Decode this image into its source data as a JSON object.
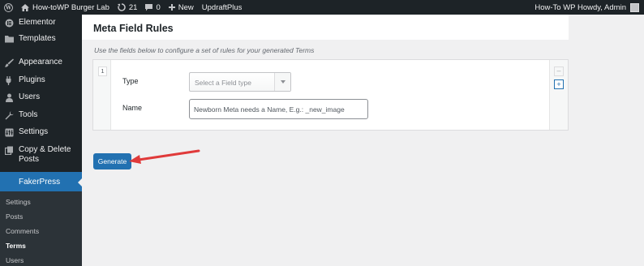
{
  "adminbar": {
    "site_name": "How-toWP Burger Lab",
    "updates_count": "21",
    "comments_count": "0",
    "new_label": "New",
    "plugin_link": "UpdraftPlus",
    "howdy_text": "How-To WP Howdy, Admin"
  },
  "sidebar": {
    "items": [
      {
        "label": "Elementor",
        "icon": "elementor-icon"
      },
      {
        "label": "Templates",
        "icon": "folder-icon"
      },
      {
        "label": "Appearance",
        "icon": "paintbrush-icon"
      },
      {
        "label": "Plugins",
        "icon": "plugin-icon"
      },
      {
        "label": "Users",
        "icon": "users-icon"
      },
      {
        "label": "Tools",
        "icon": "wrench-icon"
      },
      {
        "label": "Settings",
        "icon": "settings-icon"
      },
      {
        "label": "Copy & Delete",
        "label2": "Posts",
        "icon": "copy-icon"
      }
    ],
    "active": {
      "label": "FakerPress"
    },
    "submenu": [
      "Settings",
      "Posts",
      "Comments",
      "Terms",
      "Users"
    ],
    "current_submenu": "Terms"
  },
  "main": {
    "title": "Meta Field Rules",
    "description": "Use the fields below to configure a set of rules for your generated Terms",
    "rule": {
      "index": "1",
      "type_label": "Type",
      "type_placeholder": "Select a Field type",
      "name_label": "Name",
      "name_placeholder": "Newborn Meta needs a Name, E.g.: _new_image",
      "remove_symbol": "–",
      "add_symbol": "+"
    },
    "generate_label": "Generate"
  },
  "colors": {
    "adminbar_bg": "#1d2327",
    "accent": "#2271b1",
    "annotation_arrow": "#e03a3a"
  }
}
